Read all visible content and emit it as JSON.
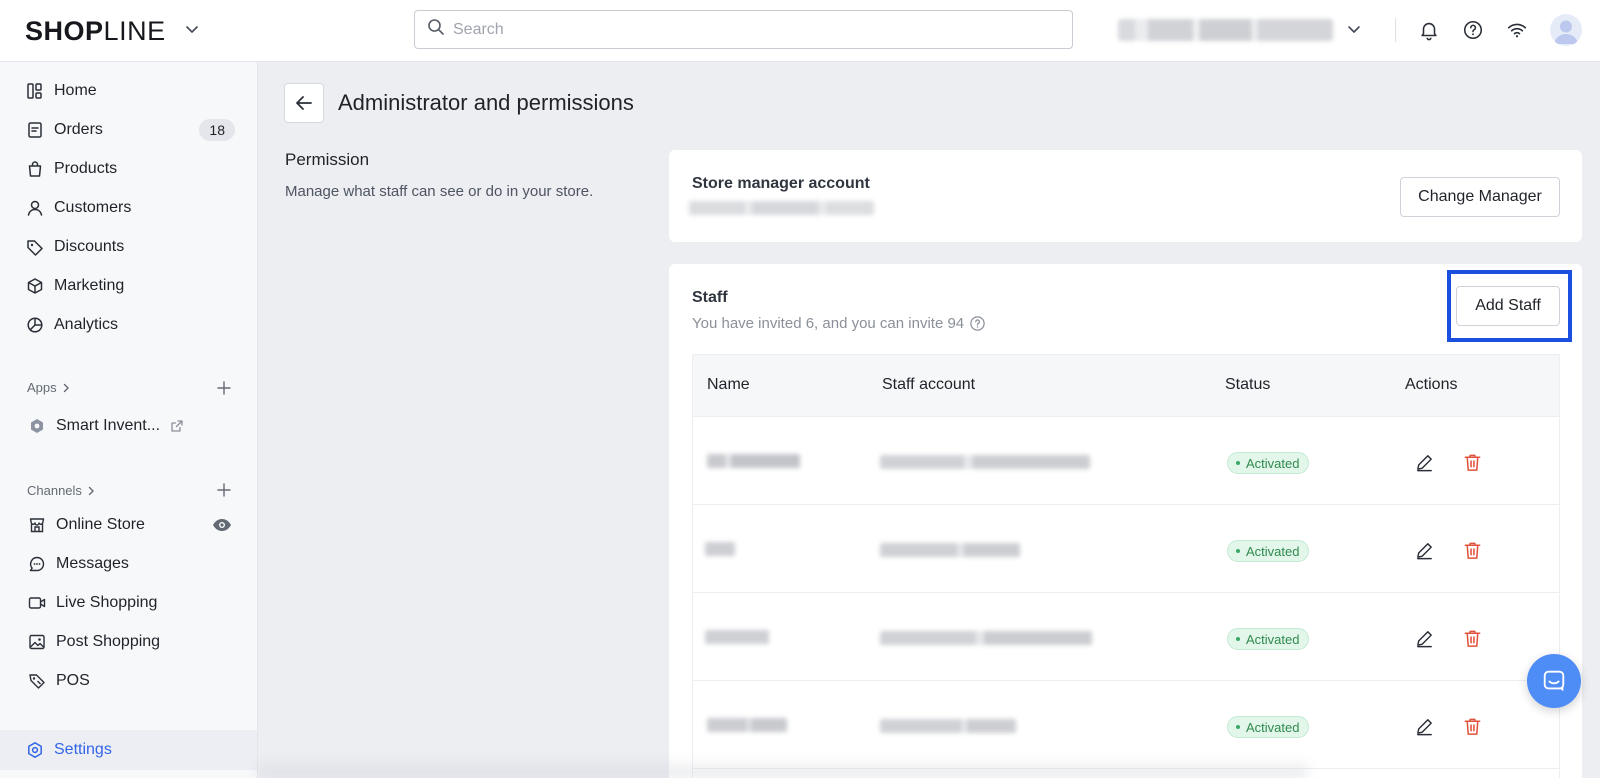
{
  "header": {
    "logo_bold": "SH",
    "logo_o": "O",
    "logo_rest_bold": "P",
    "logo_light": "LINE",
    "search_placeholder": "Search"
  },
  "sidebar": {
    "items": [
      {
        "label": "Home",
        "icon": "dashboard-icon"
      },
      {
        "label": "Orders",
        "icon": "orders-icon",
        "badge": "18"
      },
      {
        "label": "Products",
        "icon": "bag-icon"
      },
      {
        "label": "Customers",
        "icon": "user-icon"
      },
      {
        "label": "Discounts",
        "icon": "tag-icon"
      },
      {
        "label": "Marketing",
        "icon": "box-icon"
      },
      {
        "label": "Analytics",
        "icon": "pie-chart-icon"
      }
    ],
    "apps_label": "Apps",
    "apps": [
      {
        "label": "Smart Invent...",
        "icon": "hexagon-icon"
      }
    ],
    "channels_label": "Channels",
    "channels": [
      {
        "label": "Online Store",
        "icon": "store-icon"
      },
      {
        "label": "Messages",
        "icon": "chat-icon"
      },
      {
        "label": "Live Shopping",
        "icon": "video-icon"
      },
      {
        "label": "Post Shopping",
        "icon": "image-icon"
      },
      {
        "label": "POS",
        "icon": "pos-tag-icon"
      }
    ],
    "settings_label": "Settings"
  },
  "main": {
    "page_title": "Administrator and permissions",
    "permission_title": "Permission",
    "permission_desc": "Manage what staff can see or do in your store.",
    "manager_card": {
      "title": "Store manager account",
      "button": "Change Manager"
    },
    "staff_card": {
      "title": "Staff",
      "subtitle": "You have invited 6, and you can invite 94",
      "button": "Add Staff",
      "columns": [
        "Name",
        "Staff account",
        "Status",
        "Actions"
      ],
      "rows": [
        {
          "status": "Activated"
        },
        {
          "status": "Activated"
        },
        {
          "status": "Activated"
        },
        {
          "status": "Activated"
        }
      ]
    }
  },
  "colors": {
    "accent": "#3366e6",
    "highlight_border": "#1a4fe0",
    "status_green": "#2f8a4f",
    "delete_red": "#e0533d",
    "chat_fab": "#4e8df5"
  }
}
